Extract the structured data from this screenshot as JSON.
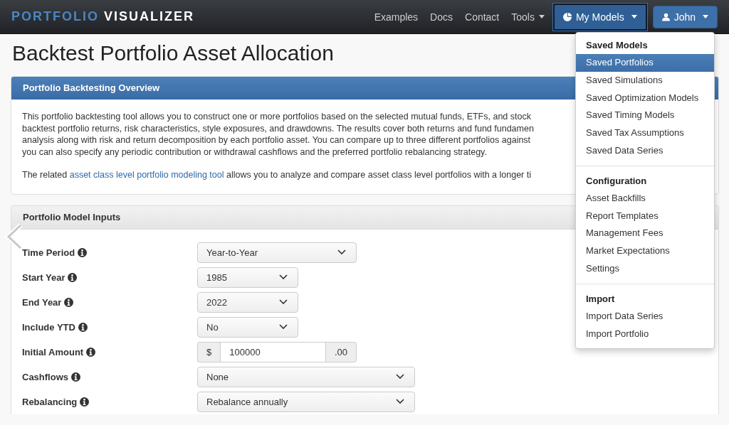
{
  "brand": {
    "first": "PORTFOLIO",
    "second": "VISUALIZER"
  },
  "nav": [
    {
      "label": "Examples",
      "dropdown": false
    },
    {
      "label": "Docs",
      "dropdown": false
    },
    {
      "label": "Contact",
      "dropdown": false
    },
    {
      "label": "Tools",
      "dropdown": true
    }
  ],
  "models_button": {
    "label": "My Models",
    "open": true
  },
  "user_button": {
    "label": "John",
    "open": false
  },
  "title": "Backtest Portfolio Asset Allocation",
  "overview": {
    "heading": "Portfolio Backtesting Overview",
    "lines": [
      "This portfolio backtesting tool allows you to construct one or more portfolios based on the selected mutual funds, ETFs, and stock",
      "backtest portfolio returns, risk characteristics, style exposures, and drawdowns. The results cover both returns and fund fundamen",
      "analysis along with risk and return decomposition by each portfolio asset. You can compare up to three different portfolios against",
      "you can also specify any periodic contribution or withdrawal cashflows and the preferred portfolio rebalancing strategy."
    ],
    "related": {
      "before": "The related",
      "link": "asset class level portfolio modeling tool",
      "after": "allows you to analyze and compare asset class level portfolios with a longer ti"
    }
  },
  "inputs": {
    "heading": "Portfolio Model Inputs",
    "rows": [
      {
        "label": "Time Period",
        "kind": "select_medium",
        "value": "Year-to-Year"
      },
      {
        "label": "Start Year",
        "kind": "select_short",
        "value": "1985"
      },
      {
        "label": "End Year",
        "kind": "select_short",
        "value": "2022"
      },
      {
        "label": "Include YTD",
        "kind": "select_short",
        "value": "No"
      },
      {
        "label": "Initial Amount",
        "kind": "amount",
        "prefix": "$",
        "value": "100000",
        "suffix": ".00"
      },
      {
        "label": "Cashflows",
        "kind": "select_wide",
        "value": "None"
      },
      {
        "label": "Rebalancing",
        "kind": "select_wide",
        "value": "Rebalance annually"
      }
    ]
  },
  "menu": [
    {
      "header": "Saved Models",
      "items": [
        {
          "label": "Saved Portfolios",
          "selected": true
        },
        {
          "label": "Saved Simulations",
          "selected": false
        },
        {
          "label": "Saved Optimization Models",
          "selected": false
        },
        {
          "label": "Saved Timing Models",
          "selected": false
        },
        {
          "label": "Saved Tax Assumptions",
          "selected": false
        },
        {
          "label": "Saved Data Series",
          "selected": false
        }
      ]
    },
    {
      "header": "Configuration",
      "items": [
        {
          "label": "Asset Backfills",
          "selected": false
        },
        {
          "label": "Report Templates",
          "selected": false
        },
        {
          "label": "Management Fees",
          "selected": false
        },
        {
          "label": "Market Expectations",
          "selected": false
        },
        {
          "label": "Settings",
          "selected": false
        }
      ]
    },
    {
      "header": "Import",
      "items": [
        {
          "label": "Import Data Series",
          "selected": false
        },
        {
          "label": "Import Portfolio",
          "selected": false
        }
      ]
    }
  ]
}
